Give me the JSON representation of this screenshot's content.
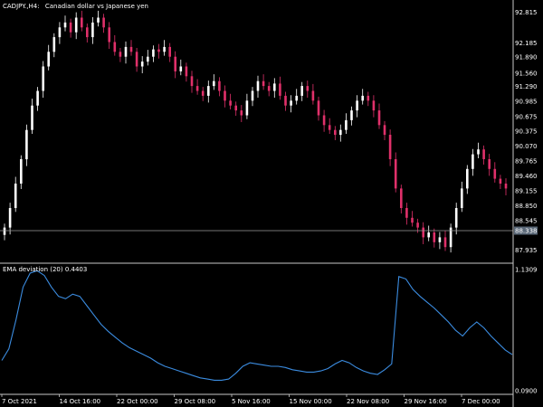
{
  "header": {
    "symbol": "CADJPY.,H4:",
    "description": "Canadian dollar vs Japanese yen"
  },
  "indicator": {
    "label": "EMA deviation (20) 0.4403"
  },
  "colors": {
    "background": "#000000",
    "bull": "#ffffff",
    "bear": "#e0306a",
    "indicator": "#3b8ce0",
    "grid_line": "#9a9a9a",
    "price_box": "#5a6878"
  },
  "price_axis": {
    "labels": [
      "92.815",
      "92.185",
      "91.890",
      "91.560",
      "91.290",
      "90.985",
      "90.675",
      "90.375",
      "90.070",
      "89.765",
      "89.460",
      "89.155",
      "88.850",
      "88.545",
      "87.935"
    ],
    "current_price": "88.338"
  },
  "indicator_axis": {
    "labels": [
      "1.1309",
      "0.0900"
    ]
  },
  "time_axis": {
    "labels": [
      "7 Oct 2021",
      "14 Oct 16:00",
      "22 Oct 00:00",
      "29 Oct 08:00",
      "5 Nov 16:00",
      "15 Nov 00:00",
      "22 Nov 08:00",
      "29 Nov 16:00",
      "7 Dec 00:00"
    ]
  },
  "chart_data": [
    {
      "type": "candlestick",
      "title": "CADJPY.,H4:",
      "subtitle": "Canadian dollar vs Japanese yen",
      "ylim": [
        87.8,
        92.95
      ],
      "x": [
        "7 Oct 2021",
        "14 Oct 16:00",
        "22 Oct 00:00",
        "29 Oct 08:00",
        "5 Nov 16:00",
        "15 Nov 00:00",
        "22 Nov 08:00",
        "29 Nov 16:00",
        "7 Dec 00:00"
      ],
      "close": [
        88.4,
        88.8,
        89.3,
        89.8,
        90.4,
        90.9,
        91.2,
        91.7,
        92.0,
        92.3,
        92.5,
        92.6,
        92.4,
        92.7,
        92.5,
        92.3,
        92.6,
        92.7,
        92.5,
        92.2,
        92.0,
        91.9,
        92.1,
        92.0,
        91.7,
        91.8,
        91.9,
        92.05,
        92.0,
        92.1,
        91.9,
        91.6,
        91.7,
        91.5,
        91.3,
        91.2,
        91.1,
        91.3,
        91.4,
        91.2,
        91.0,
        90.9,
        90.8,
        90.7,
        91.0,
        91.2,
        91.4,
        91.3,
        91.2,
        91.35,
        91.1,
        90.9,
        91.0,
        91.1,
        91.3,
        91.2,
        91.0,
        90.7,
        90.5,
        90.4,
        90.3,
        90.4,
        90.6,
        90.8,
        91.0,
        91.1,
        91.0,
        90.8,
        90.5,
        90.3,
        89.8,
        89.2,
        88.8,
        88.6,
        88.5,
        88.4,
        88.2,
        88.3,
        88.1,
        88.2,
        88.0,
        88.4,
        88.8,
        89.2,
        89.6,
        89.9,
        90.0,
        89.8,
        89.6,
        89.4,
        89.3,
        89.2
      ],
      "ema20": []
    },
    {
      "type": "line",
      "title": "EMA deviation (20) 0.4403",
      "ylim": [
        0.09,
        1.1309
      ],
      "series": [
        {
          "values": [
            0.35,
            0.45,
            0.7,
            0.98,
            1.1,
            1.12,
            1.08,
            0.98,
            0.9,
            0.88,
            0.92,
            0.9,
            0.82,
            0.74,
            0.66,
            0.6,
            0.55,
            0.5,
            0.46,
            0.43,
            0.4,
            0.37,
            0.33,
            0.3,
            0.28,
            0.26,
            0.24,
            0.22,
            0.2,
            0.19,
            0.18,
            0.18,
            0.19,
            0.24,
            0.3,
            0.33,
            0.32,
            0.31,
            0.3,
            0.3,
            0.29,
            0.27,
            0.26,
            0.25,
            0.25,
            0.26,
            0.28,
            0.32,
            0.35,
            0.33,
            0.29,
            0.26,
            0.24,
            0.23,
            0.27,
            0.32,
            1.07,
            1.05,
            0.96,
            0.9,
            0.85,
            0.8,
            0.74,
            0.68,
            0.61,
            0.56,
            0.63,
            0.68,
            0.63,
            0.56,
            0.5,
            0.44,
            0.4
          ]
        }
      ]
    }
  ]
}
